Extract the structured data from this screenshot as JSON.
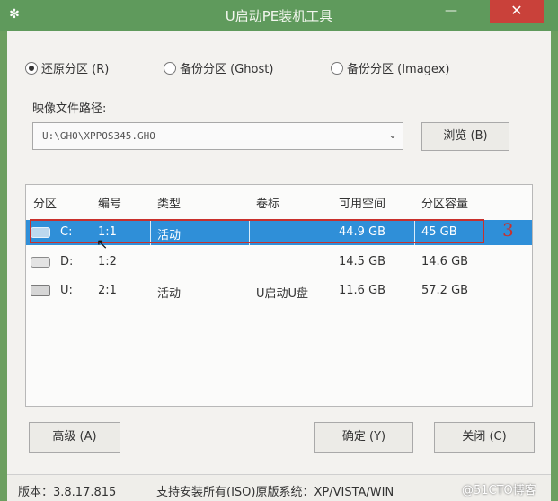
{
  "window": {
    "title": "U启动PE装机工具",
    "minimize_label": "—",
    "close_label": "✕"
  },
  "mode": {
    "options": [
      {
        "label": "还原分区 (R)",
        "selected": true
      },
      {
        "label": "备份分区 (Ghost)",
        "selected": false
      },
      {
        "label": "备份分区 (Imagex)",
        "selected": false
      }
    ]
  },
  "image": {
    "label": "映像文件路径:",
    "path": "U:\\GHO\\XPPOS345.GHO",
    "browse_label": "浏览 (B)"
  },
  "partitions": {
    "headers": [
      "分区",
      "编号",
      "类型",
      "卷标",
      "可用空间",
      "分区容量"
    ],
    "rows": [
      {
        "drive": "C:",
        "number": "1:1",
        "type": "活动",
        "label": "",
        "free": "44.9 GB",
        "size": "45 GB",
        "selected": true,
        "icon": "hard-drive-icon"
      },
      {
        "drive": "D:",
        "number": "1:2",
        "type": "",
        "label": "",
        "free": "14.5 GB",
        "size": "14.6 GB",
        "selected": false,
        "icon": "hard-drive-icon"
      },
      {
        "drive": "U:",
        "number": "2:1",
        "type": "活动",
        "label": "U启动U盘",
        "free": "11.6 GB",
        "size": "57.2 GB",
        "selected": false,
        "icon": "usb-drive-icon"
      }
    ]
  },
  "annotation": {
    "number": "3",
    "color": "#c9302c"
  },
  "buttons": {
    "advanced": "高级 (A)",
    "ok": "确定 (Y)",
    "close": "关闭 (C)"
  },
  "status": {
    "version": "版本：3.8.17.815",
    "support": "支持安装所有(ISO)原版系统：XP/VISTA/WIN"
  },
  "watermark": "@51CTO博客",
  "colors": {
    "titlebar": "#5f9a5c",
    "selection": "#2f8fd8",
    "close": "#c9413a"
  }
}
